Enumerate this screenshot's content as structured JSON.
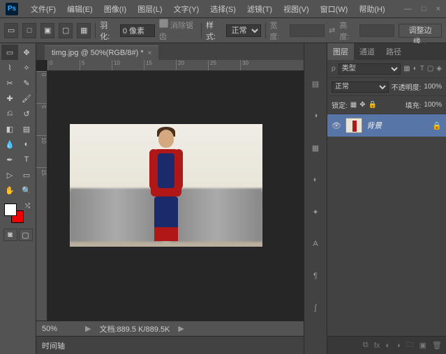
{
  "titlebar": {
    "logo": "Ps",
    "menus": [
      "文件(F)",
      "编辑(E)",
      "图像(I)",
      "图层(L)",
      "文字(Y)",
      "选择(S)",
      "滤镜(T)",
      "视图(V)",
      "窗口(W)",
      "帮助(H)"
    ],
    "window_controls": [
      "—",
      "□",
      "×"
    ]
  },
  "options": {
    "feather_label": "羽化:",
    "feather_value": "0 像素",
    "antialias_label": "消除锯齿",
    "style_label": "样式:",
    "style_value": "正常",
    "width_label": "宽度:",
    "height_label": "高度:",
    "refine_btn": "调整边缘..."
  },
  "document": {
    "tab_title": "timg.jpg @ 50%(RGB/8#) *",
    "ruler_h": [
      "0",
      "5",
      "10",
      "15",
      "20",
      "25",
      "30"
    ],
    "ruler_v": [
      "0",
      "5",
      "10",
      "15"
    ]
  },
  "status": {
    "zoom": "50%",
    "doc_info": "文档:889.5 K/889.5K"
  },
  "timeline": {
    "label": "时间轴"
  },
  "panels": {
    "tabs": [
      "图层",
      "通道",
      "路径"
    ],
    "filter_label": "类型",
    "blend_mode": "正常",
    "opacity_label": "不透明度:",
    "opacity_value": "100%",
    "lock_label": "锁定:",
    "fill_label": "填充:",
    "fill_value": "100%",
    "layer": {
      "name": "背景"
    }
  }
}
